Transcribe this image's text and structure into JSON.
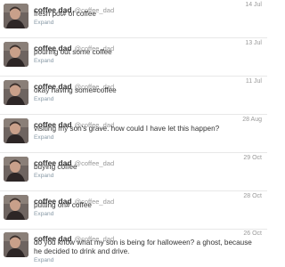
{
  "tweets": [
    {
      "name": "coffee dad",
      "handle": "@coffee_dad",
      "date": "14 Jul",
      "text": "fresh pot# of coffee",
      "expand": "Expand"
    },
    {
      "name": "coffee dad",
      "handle": "@coffee_dad",
      "date": "13 Jul",
      "text": "pouring out some coffee",
      "expand": "Expand"
    },
    {
      "name": "coffee dad",
      "handle": "@coffee_dad",
      "date": "11 Jul",
      "text": "okay having some#coffee",
      "expand": "Expand"
    },
    {
      "name": "coffee dad",
      "handle": "@coffee_dad",
      "date": "28 Aug",
      "text": "visiting my son's grave. how could I have let this happen?",
      "expand": "Expand"
    },
    {
      "name": "coffee dad",
      "handle": "@coffee_dad",
      "date": "29 Oct",
      "text": "buying coffee",
      "expand": "Expand"
    },
    {
      "name": "coffee dad",
      "handle": "@coffee_dad",
      "date": "28 Oct",
      "text": "putting on# coffee",
      "expand": "Expand"
    },
    {
      "name": "coffee dad",
      "handle": "@coffee_dad",
      "date": "26 Oct",
      "text": "do you know what my son is being for halloween? a ghost, because he decided to drink and drive.",
      "expand": "Expand"
    }
  ]
}
